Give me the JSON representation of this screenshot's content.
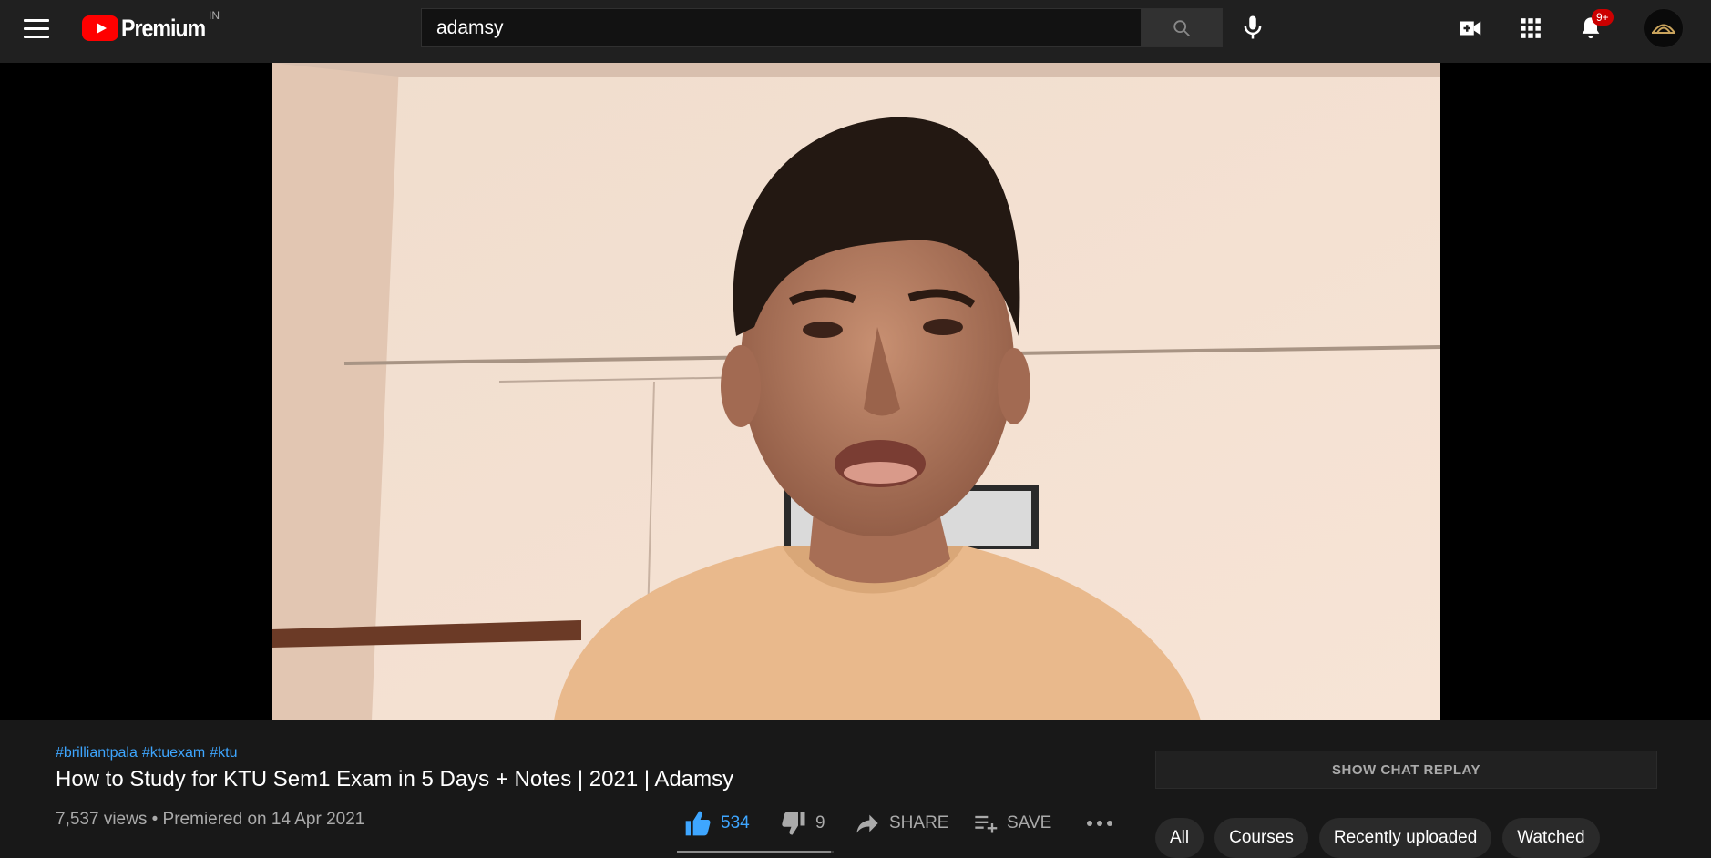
{
  "header": {
    "logo_text": "Premium",
    "country_code": "IN",
    "search_value": "adamsy",
    "notification_count": "9+",
    "icons": [
      "menu-icon",
      "search-icon",
      "mic-icon",
      "create-video-icon",
      "apps-grid-icon",
      "bell-icon",
      "avatar"
    ]
  },
  "video": {
    "hashtags": [
      "#brilliantpala",
      "#ktuexam",
      "#ktu"
    ],
    "title": "How to Study for KTU Sem1 Exam in 5 Days + Notes | 2021 | Adamsy",
    "meta": "7,537 views • Premiered on 14 Apr 2021",
    "like_ratio": 0.98
  },
  "actions": {
    "likes": "534",
    "dislikes": "9",
    "share": "SHARE",
    "save": "SAVE"
  },
  "sidebar": {
    "chat_replay": "SHOW CHAT REPLAY",
    "chips": [
      "All",
      "Courses",
      "Recently uploaded",
      "Watched"
    ]
  },
  "colors": {
    "accent_blue": "#3ea6ff",
    "brand_red": "#ff0000",
    "background": "#181818"
  }
}
